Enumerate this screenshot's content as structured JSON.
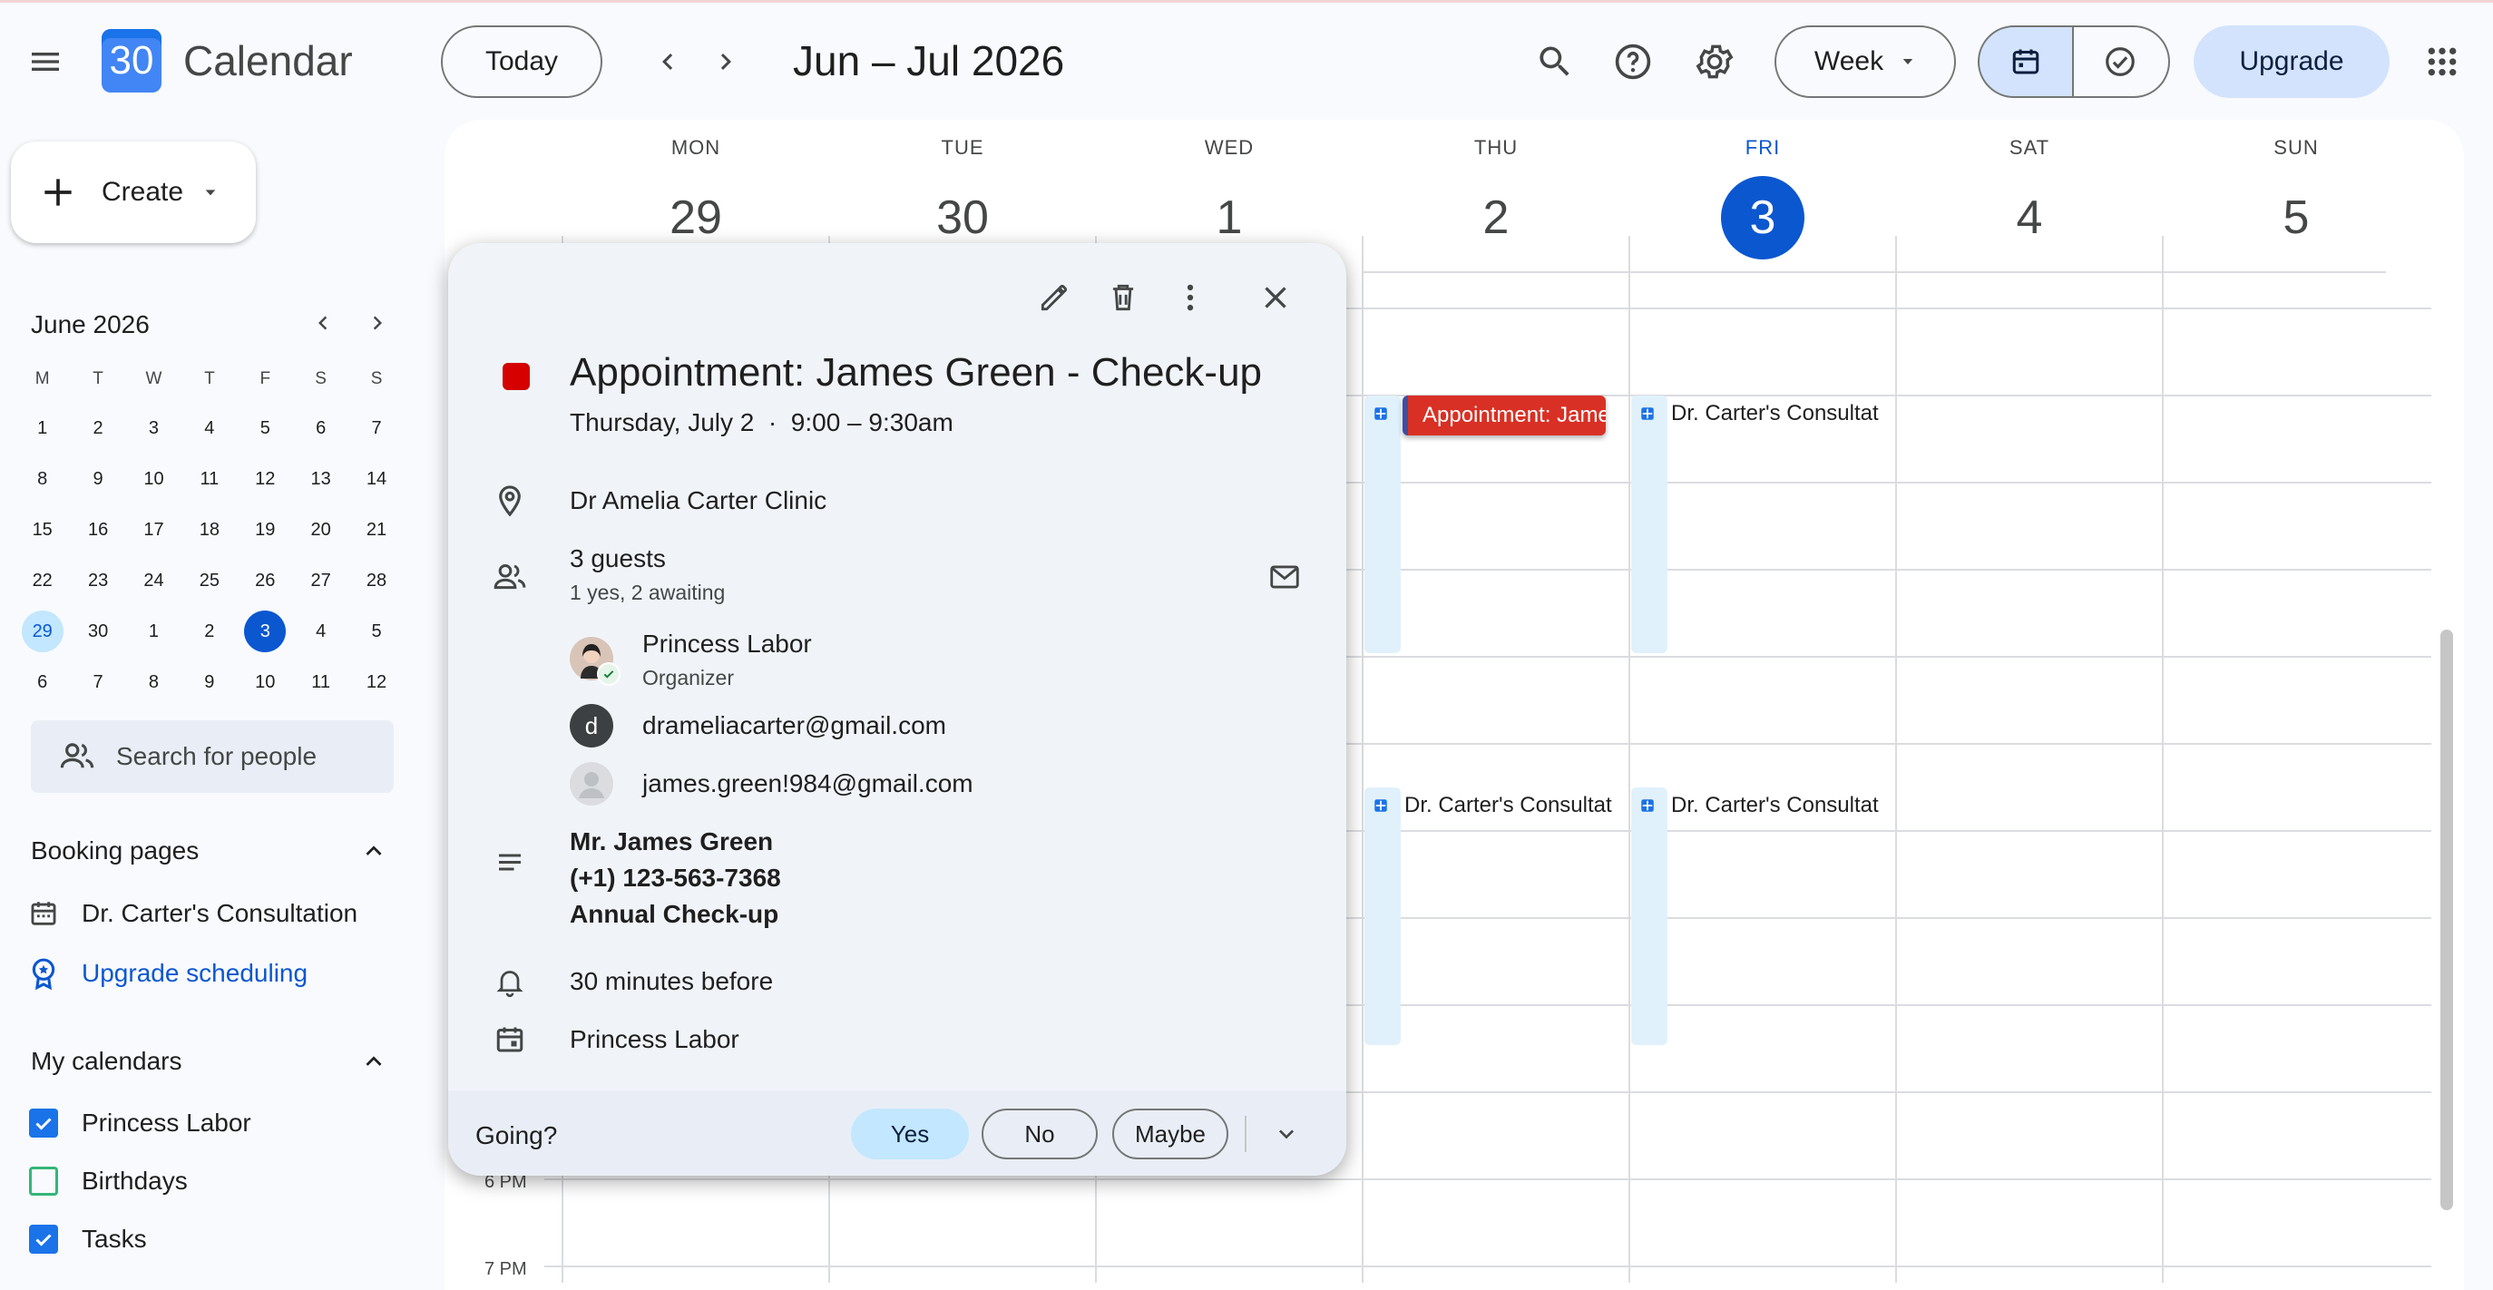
{
  "header": {
    "app_title": "Calendar",
    "logo_text": "30",
    "today_label": "Today",
    "date_range": "Jun – Jul 2026",
    "view_label": "Week",
    "upgrade_label": "Upgrade"
  },
  "sidebar": {
    "create_label": "Create",
    "mini_cal": {
      "title": "June 2026",
      "weekdays": [
        "M",
        "T",
        "W",
        "T",
        "F",
        "S",
        "S"
      ],
      "weeks": [
        [
          "1",
          "2",
          "3",
          "4",
          "5",
          "6",
          "7"
        ],
        [
          "8",
          "9",
          "10",
          "11",
          "12",
          "13",
          "14"
        ],
        [
          "15",
          "16",
          "17",
          "18",
          "19",
          "20",
          "21"
        ],
        [
          "22",
          "23",
          "24",
          "25",
          "26",
          "27",
          "28"
        ],
        [
          "29",
          "30",
          "1",
          "2",
          "3",
          "4",
          "5"
        ],
        [
          "6",
          "7",
          "8",
          "9",
          "10",
          "11",
          "12"
        ]
      ]
    },
    "search_placeholder": "Search for people",
    "booking_title": "Booking pages",
    "booking_item": "Dr. Carter's Consultation",
    "upgrade_scheduling": "Upgrade scheduling",
    "my_calendars_title": "My calendars",
    "calendars": [
      {
        "label": "Princess Labor",
        "checked": true,
        "color": "#1a73e8"
      },
      {
        "label": "Birthdays",
        "checked": false,
        "color": "#33b679"
      },
      {
        "label": "Tasks",
        "checked": true,
        "color": "#1a73e8"
      }
    ]
  },
  "week": {
    "days": [
      {
        "name": "MON",
        "date": "29"
      },
      {
        "name": "TUE",
        "date": "30"
      },
      {
        "name": "WED",
        "date": "1"
      },
      {
        "name": "THU",
        "date": "2"
      },
      {
        "name": "FRI",
        "date": "3",
        "today": true
      },
      {
        "name": "SAT",
        "date": "4"
      },
      {
        "name": "SUN",
        "date": "5"
      }
    ],
    "time_labels": [
      "6 PM",
      "7 PM"
    ],
    "events": {
      "red_event": "Appointment: James Green - Check-up",
      "consult_fri_1": "Dr. Carter's Consultation",
      "consult_thu_2": "Dr. Carter's Consultation",
      "consult_fri_2": "Dr. Carter's Consultation"
    }
  },
  "popup": {
    "title": "Appointment: James Green - Check-up",
    "date_line": "Thursday, July 2  ·  9:00 – 9:30am",
    "location": "Dr Amelia Carter Clinic",
    "guests_count": "3 guests",
    "guests_status": "1 yes, 2 awaiting",
    "guests": [
      {
        "name": "Princess Labor",
        "role": "Organizer"
      },
      {
        "name": "drameliacarter@gmail.com",
        "initial": "d"
      },
      {
        "name": "james.green!984@gmail.com"
      }
    ],
    "description": [
      "Mr. James Green",
      "(+1) 123-563-7368",
      "Annual Check-up"
    ],
    "reminder": "30 minutes before",
    "calendar": "Princess Labor",
    "going_label": "Going?",
    "rsvp": {
      "yes": "Yes",
      "no": "No",
      "maybe": "Maybe"
    },
    "event_color": "#d50000"
  }
}
